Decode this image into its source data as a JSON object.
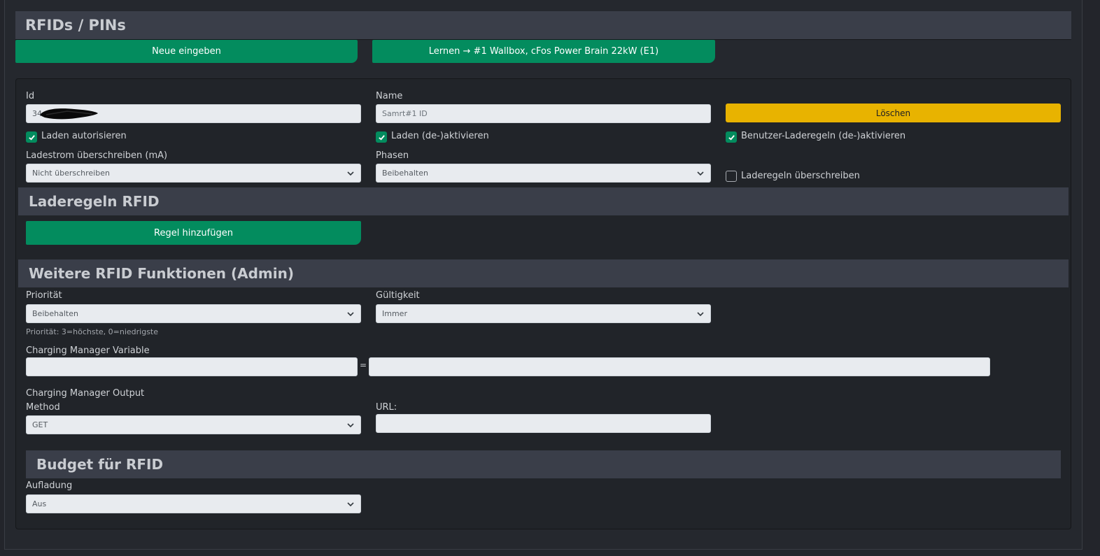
{
  "section": {
    "title": "RFIDs / PINs"
  },
  "top_buttons": {
    "new": "Neue eingeben",
    "learn": "Lernen → #1 Wallbox, cFos Power Brain 22kW (E1)"
  },
  "form": {
    "id_label": "Id",
    "id_value": "34",
    "name_label": "Name",
    "name_placeholder": "Samrt#1 ID",
    "delete_label": "Löschen",
    "cb_authorize": "Laden autorisieren",
    "cb_deactivate": "Laden (de-)aktivieren",
    "cb_user_rules": "Benutzer-Laderegeln (de-)aktivieren",
    "current_label": "Ladestrom überschreiben (mA)",
    "current_value": "Nicht überschreiben",
    "phases_label": "Phasen",
    "phases_value": "Beibehalten",
    "cb_override_rules": "Laderegeln überschreiben"
  },
  "rules": {
    "title": "Laderegeln RFID",
    "add_button": "Regel hinzufügen"
  },
  "admin": {
    "title": "Weitere RFID Funktionen (Admin)",
    "priority_label": "Priorität",
    "priority_value": "Beibehalten",
    "priority_hint": "Priorität: 3=höchste, 0=niedrigste",
    "validity_label": "Gültigkeit",
    "validity_value": "Immer",
    "cm_variable_label": "Charging Manager Variable",
    "equals": "=",
    "cm_output_label": "Charging Manager Output",
    "method_label": "Method",
    "method_value": "GET",
    "url_label": "URL:"
  },
  "budget": {
    "title": "Budget für RFID",
    "charge_label": "Aufladung",
    "charge_value": "Aus"
  },
  "colors": {
    "accent_green": "#038c5e",
    "warning_yellow": "#e8b300",
    "header_bg": "#3a3e49",
    "page_bg": "#23252b"
  }
}
